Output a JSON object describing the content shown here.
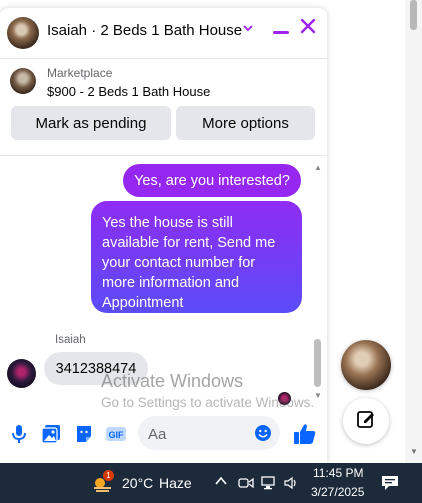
{
  "chat": {
    "title": "Isaiah · 2 Beds 1 Bath House",
    "listing": {
      "source": "Marketplace",
      "title": "$900 - 2 Beds 1 Bath House"
    },
    "actions": {
      "mark_pending": "Mark as pending",
      "more_options": "More options"
    },
    "messages": [
      {
        "from": "me",
        "text": "Yes, are you interested?"
      },
      {
        "from": "me",
        "text": "Yes the house is still available for rent, Send me your contact number for more information and Appointment"
      },
      {
        "from": "Isaiah",
        "text": "3412388474"
      }
    ],
    "sender_name": "Isaiah",
    "composer": {
      "placeholder": "Aa"
    }
  },
  "watermark": {
    "title": "Activate Windows",
    "subtitle": "Go to Settings to activate Windows."
  },
  "taskbar": {
    "weather_badge": "1",
    "temperature": "20°C",
    "condition": "Haze",
    "time": "11:45 PM",
    "date": "3/27/2025"
  },
  "colors": {
    "accent": "#a020f0",
    "bubble_top": "#8f2cf3",
    "bubble_bottom": "#5b4cf8",
    "messenger_blue": "#0866ff",
    "taskbar": "#1c2a3a"
  },
  "icons": [
    "chevron-down-icon",
    "minimize-icon",
    "close-icon",
    "microphone-icon",
    "image-icon",
    "sticker-icon",
    "gif-icon",
    "emoji-icon",
    "thumbs-up-icon",
    "compose-icon",
    "weather-icon",
    "wifi-icon",
    "volume-icon",
    "notification-icon"
  ]
}
